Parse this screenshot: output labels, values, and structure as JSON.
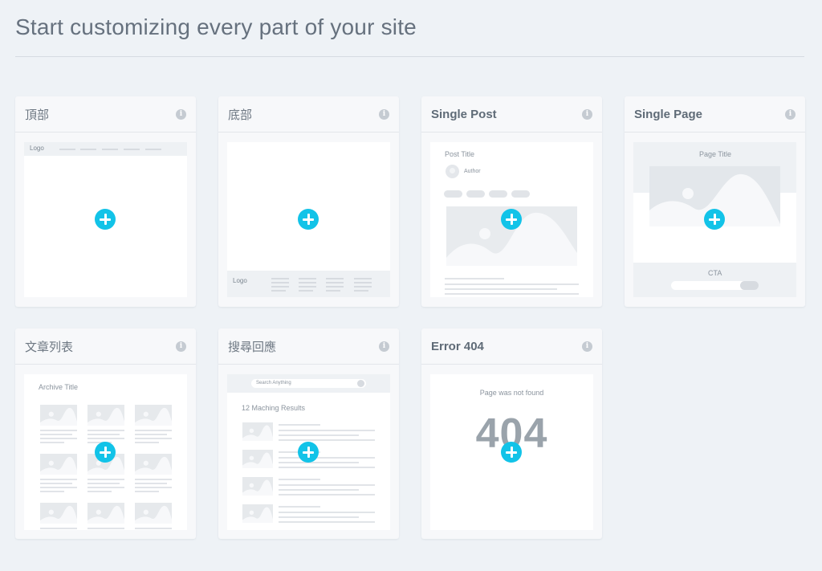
{
  "page": {
    "title": "Start customizing every part of your site"
  },
  "cards": [
    {
      "id": "header",
      "title": "頂部",
      "preview": {
        "logo": "Logo"
      }
    },
    {
      "id": "footer",
      "title": "底部",
      "preview": {
        "logo": "Logo"
      }
    },
    {
      "id": "single-post",
      "title": "Single Post",
      "preview": {
        "post_title": "Post Title",
        "author": "Author"
      }
    },
    {
      "id": "single-page",
      "title": "Single Page",
      "preview": {
        "page_title": "Page Title",
        "cta": "CTA"
      }
    },
    {
      "id": "archive",
      "title": "文章列表",
      "preview": {
        "archive_title": "Archive Title"
      }
    },
    {
      "id": "search",
      "title": "搜尋回應",
      "preview": {
        "search_placeholder": "Search Anything",
        "results": "12 Maching Results"
      }
    },
    {
      "id": "error-404",
      "title": "Error 404",
      "preview": {
        "message": "Page was not found",
        "code": "404"
      }
    }
  ],
  "info_glyph": "i",
  "colors": {
    "accent": "#12c3e8",
    "background": "#eef2f6",
    "card": "#f7f8fa"
  },
  "icons": {
    "info": "info-icon",
    "add": "plus-icon",
    "search": "search-icon",
    "image": "image-placeholder-icon",
    "avatar": "avatar-icon"
  }
}
